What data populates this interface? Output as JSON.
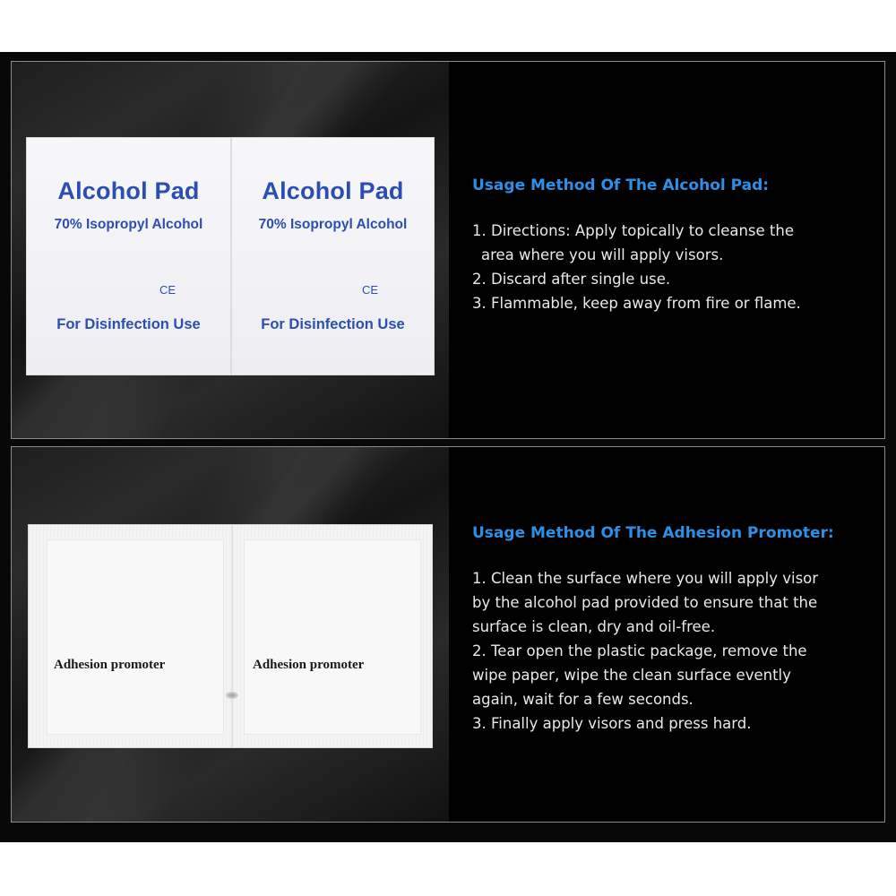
{
  "alcohol_pad": {
    "title": "Alcohol Pad",
    "subtitle": "70% Isopropyl Alcohol",
    "ce": "CE",
    "use": "For Disinfection Use"
  },
  "alcohol_section": {
    "heading": "Usage Method Of The Alcohol Pad:",
    "lines": [
      "1. Directions: Apply topically to cleanse the",
      "   area where you will apply visors.",
      "2. Discard after single use.",
      "3. Flammable, keep away from fire or flame."
    ]
  },
  "adhesion_pad": {
    "label": "Adhesion promoter"
  },
  "adhesion_section": {
    "heading": "Usage Method Of The Adhesion Promoter:",
    "lines": [
      "1. Clean the surface where you will apply visor",
      "by the alcohol pad provided to ensure that the",
      "surface is clean, dry and oil-free.",
      "2. Tear open the plastic package, remove the",
      "wipe paper, wipe the clean surface evently",
      "again, wait for a few seconds.",
      "3. Finally apply visors and press hard."
    ]
  },
  "colors": {
    "heading_blue": "#2d8fe6",
    "pad_blue": "#2a4fb0",
    "background": "#080808"
  }
}
